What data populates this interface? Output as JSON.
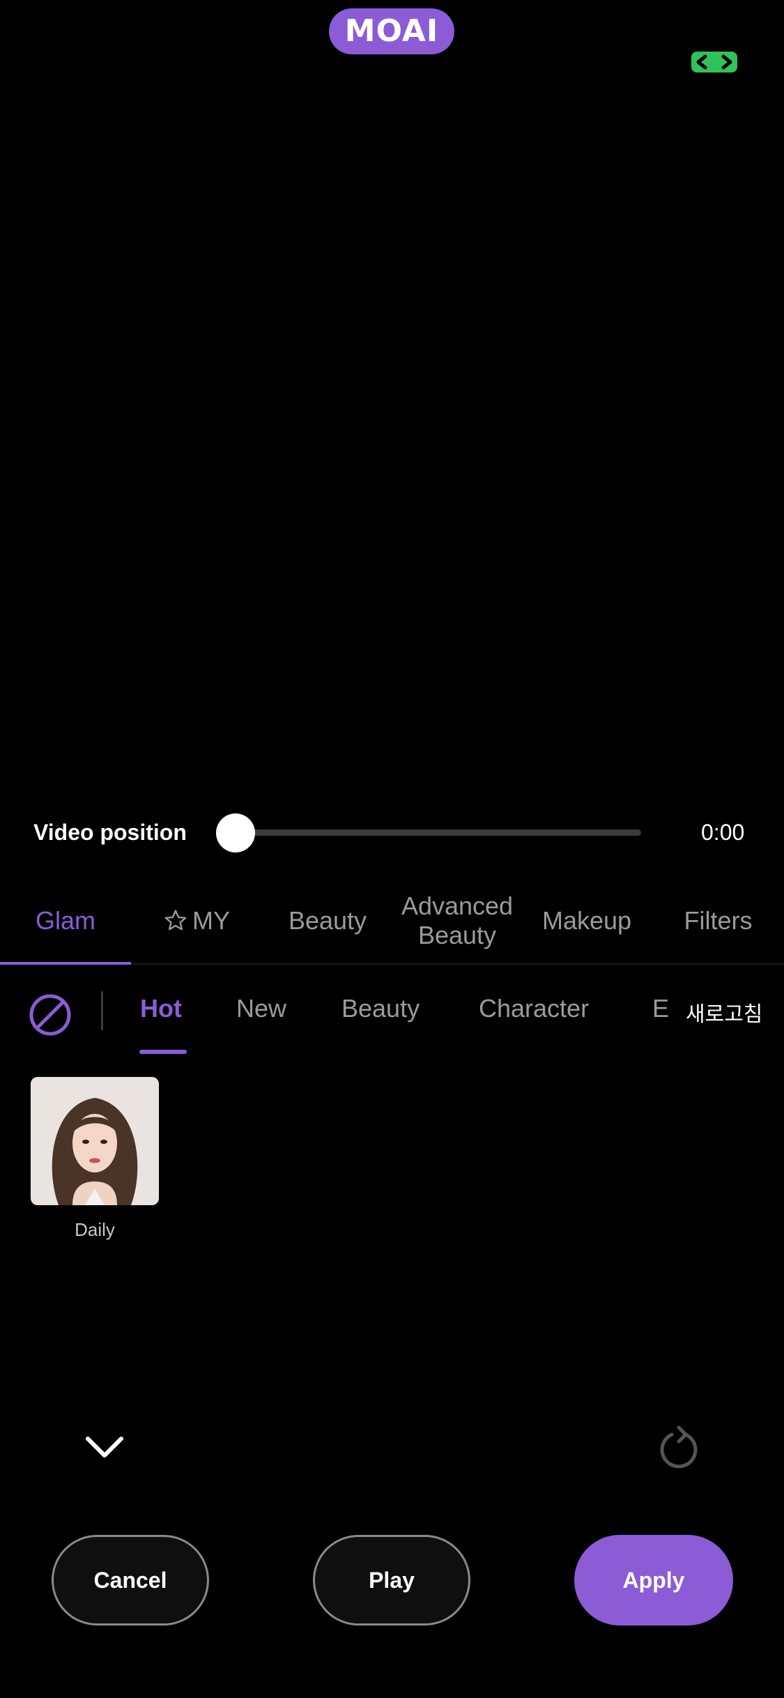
{
  "brand": {
    "logo_text": "MOAI"
  },
  "player": {
    "position_label": "Video position",
    "position_value": 0,
    "time": "0:00"
  },
  "main_tabs": [
    {
      "label": "Glam",
      "active": true
    },
    {
      "label": "MY",
      "icon": "star-icon"
    },
    {
      "label": "Beauty"
    },
    {
      "label": "Advanced Beauty"
    },
    {
      "label": "Makeup"
    },
    {
      "label": "Filters"
    }
  ],
  "sub_tabs": [
    {
      "label": "Hot",
      "active": true
    },
    {
      "label": "New"
    },
    {
      "label": "Beauty"
    },
    {
      "label": "Character"
    },
    {
      "label": "E"
    }
  ],
  "refresh_label": "새로고침",
  "filters": [
    {
      "label": "Daily",
      "icon": "portrait-thumbnail"
    }
  ],
  "actions": {
    "cancel": "Cancel",
    "play": "Play",
    "apply": "Apply"
  },
  "colors": {
    "accent": "#8b5cd6",
    "background": "#000000",
    "indicator_green": "#34c759"
  }
}
